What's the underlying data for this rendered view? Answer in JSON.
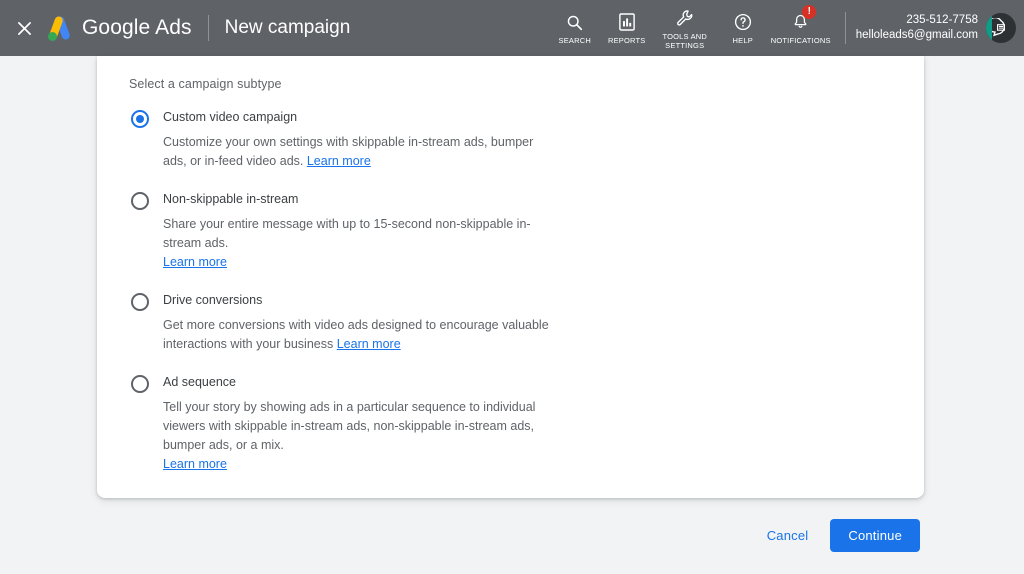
{
  "appbar": {
    "close_icon": "close-icon",
    "brand": "Google Ads",
    "page_title": "New campaign",
    "tools": [
      {
        "icon": "search-icon",
        "label": "SEARCH"
      },
      {
        "icon": "reports-icon",
        "label": "REPORTS"
      },
      {
        "icon": "tools-wrench-icon",
        "label": "TOOLS AND\nSETTINGS"
      },
      {
        "icon": "help-icon",
        "label": "HELP"
      },
      {
        "icon": "notifications-bell-icon",
        "label": "NOTIFICATIONS",
        "badge": "!"
      }
    ],
    "account": {
      "id": "235-512-7758",
      "email": "helloleads6@gmail.com",
      "avatar_icon": "chat-avatar-icon"
    }
  },
  "main": {
    "heading": "Select a campaign subtype",
    "options": [
      {
        "title": "Custom video campaign",
        "selected": true,
        "desc": "Customize your own settings with skippable in-stream ads, bumper ads, or in-feed video ads.",
        "link": "Learn more",
        "link_inline": true
      },
      {
        "title": "Non-skippable in-stream",
        "selected": false,
        "desc": "Share your entire message with up to 15-second non-skippable in-stream ads.",
        "link": "Learn more",
        "link_inline": false
      },
      {
        "title": "Drive conversions",
        "selected": false,
        "desc": "Get more conversions with video ads designed to encourage valuable interactions with your business",
        "link": "Learn more",
        "link_inline": true
      },
      {
        "title": "Ad sequence",
        "selected": false,
        "desc": "Tell your story by showing ads in a particular sequence to individual viewers with skippable in-stream ads, non-skippable in-stream ads, bumper ads, or a mix.",
        "link": "Learn more",
        "link_inline": false
      }
    ]
  },
  "footer": {
    "cancel_label": "Cancel",
    "continue_label": "Continue"
  },
  "colors": {
    "appbar_bg": "#5f6368",
    "page_bg": "#f1f3f4",
    "accent_blue": "#1a73e8",
    "badge_red": "#d93025",
    "logo_blue": "#4285f4",
    "logo_yellow": "#fbbc04",
    "logo_green": "#34a853"
  }
}
